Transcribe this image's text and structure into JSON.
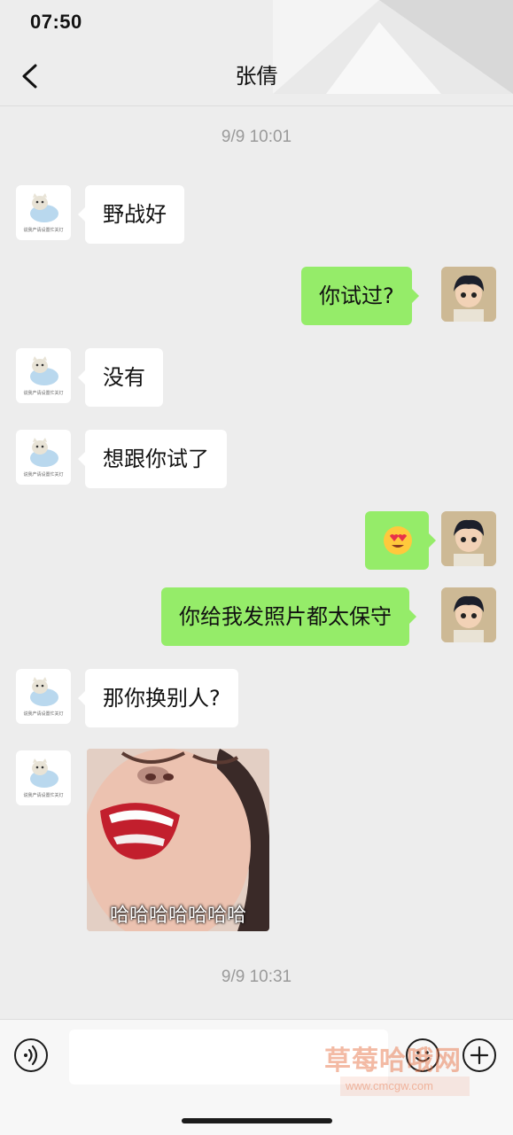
{
  "status_bar": {
    "time": "07:50"
  },
  "header": {
    "contact_name": "张倩"
  },
  "timestamps": [
    "9/9 10:01",
    "9/9 10:31"
  ],
  "messages": [
    {
      "side": "left",
      "text": "野战好"
    },
    {
      "side": "right",
      "text": "你试过?"
    },
    {
      "side": "left",
      "text": "没有"
    },
    {
      "side": "left",
      "text": "想跟你试了"
    },
    {
      "side": "right",
      "type": "emoji",
      "emoji": "heart-eyes-emoji"
    },
    {
      "side": "right",
      "text": "你给我发照片都太保守"
    },
    {
      "side": "left",
      "text": "那你换别人?"
    },
    {
      "side": "left",
      "type": "sticker",
      "caption": "哈哈哈哈哈哈哈"
    }
  ],
  "left_avatar": {
    "caption": "说我产请设置忙关灯"
  },
  "input_bar": {
    "placeholder": ""
  },
  "watermark": {
    "text": "草莓哈哦网",
    "url": "www.cmcgw.com"
  },
  "colors": {
    "background": "#ededed",
    "sent_bubble": "#95ec69",
    "received_bubble": "#ffffff"
  }
}
